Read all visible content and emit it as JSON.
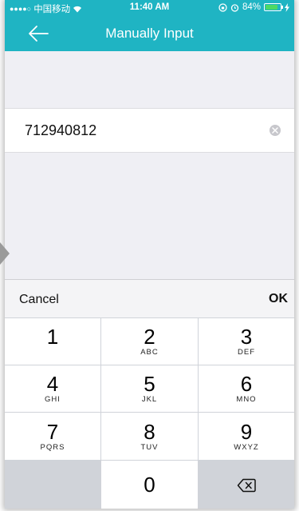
{
  "status_bar": {
    "carrier": "中国移动",
    "time": "11:40 AM",
    "battery": "84%",
    "battery_level": 0.84
  },
  "nav": {
    "title": "Manually Input",
    "back_icon": "arrow-left-icon"
  },
  "input": {
    "value": "712940812",
    "clear_icon": "clear-circle-icon"
  },
  "toolbar": {
    "cancel_label": "Cancel",
    "ok_label": "OK"
  },
  "keypad": {
    "keys": [
      {
        "num": "1",
        "sub": ""
      },
      {
        "num": "2",
        "sub": "ABC"
      },
      {
        "num": "3",
        "sub": "DEF"
      },
      {
        "num": "4",
        "sub": "GHI"
      },
      {
        "num": "5",
        "sub": "JKL"
      },
      {
        "num": "6",
        "sub": "MNO"
      },
      {
        "num": "7",
        "sub": "PQRS"
      },
      {
        "num": "8",
        "sub": "TUV"
      },
      {
        "num": "9",
        "sub": "WXYZ"
      },
      {
        "num": "0",
        "sub": ""
      }
    ],
    "delete_icon": "backspace-icon"
  },
  "colors": {
    "accent": "#1fb4c3",
    "battery_fill": "#4cd964",
    "keypad_bg": "#d0d3d9"
  }
}
